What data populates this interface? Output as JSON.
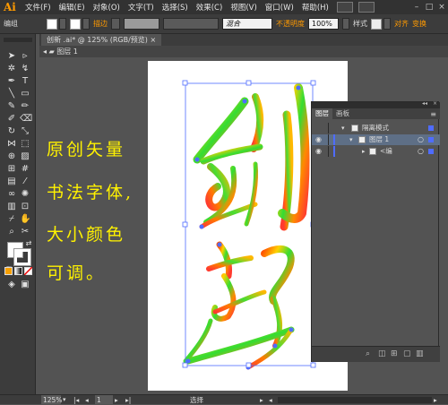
{
  "app": {
    "logo": "Ai"
  },
  "menu": [
    "文件(F)",
    "编辑(E)",
    "对象(O)",
    "文字(T)",
    "选择(S)",
    "效果(C)",
    "视图(V)",
    "窗口(W)",
    "帮助(H)"
  ],
  "control_bar": {
    "group_label": "编组",
    "stroke_label": "描边",
    "style_value": "混合",
    "opacity_label": "不透明度",
    "opacity_value": "100%",
    "style_label": "样式",
    "align_label": "对齐",
    "transform_label": "变换"
  },
  "document": {
    "tab_label": "创新 .ai* @ 125% (RGB/预览)",
    "breadcrumb": "图层 1"
  },
  "overlay_text": [
    "原创矢量",
    "书法字体,",
    "大小颜色",
    "可调。"
  ],
  "layers_panel": {
    "tabs": [
      "图层",
      "画板"
    ],
    "rows": [
      {
        "label": "隔离模式",
        "depth": 0
      },
      {
        "label": "图层 1",
        "depth": 1
      },
      {
        "label": "<编",
        "depth": 2
      }
    ]
  },
  "status_bar": {
    "zoom": "125%",
    "page": "1",
    "tool_label": "选择"
  },
  "colors": {
    "accent": "#ff9a00",
    "overlay_text": "#fff200",
    "selection_blue": "#4f6cff",
    "panel_selected": "#5e6f86"
  }
}
